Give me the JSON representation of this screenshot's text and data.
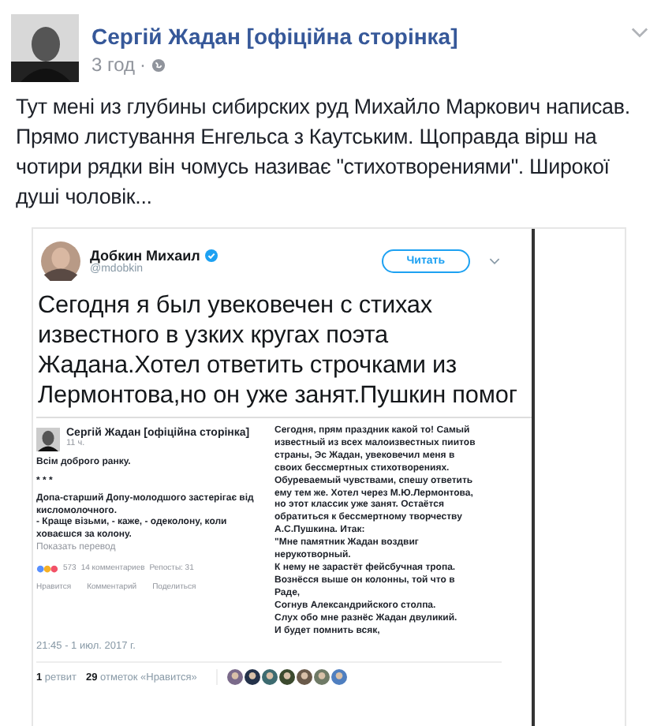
{
  "post": {
    "author": "Сергій Жадан [офіційна сторінка]",
    "time": "3 год",
    "separator": "·",
    "text": "Тут мені из глубины сибирских руд Михайло Маркович написав. Прямо листування Енгельса з Каутським. Щоправда вірш на чотири рядки він чомусь називає \"стихотворениями\". Широкої душі чоловік..."
  },
  "tweet": {
    "author": "Добкин Михаил",
    "verified": true,
    "handle": "@mdobkin",
    "follow_button": "Читать",
    "text": "Сегодня я был увековечен с стихах известного в узких кругах поэта Жадана.Хотел ответить строчками из Лермонтова,но он уже занят.Пушкин помог",
    "embedded_post": {
      "author": "Сергій Жадан [офіційна сторінка]",
      "time": "11 ч.",
      "greeting": "Всім доброго ранку.",
      "stars": "* * *",
      "poem": "Допа-старший Допу-молодшого застерігає від кисломолочного.\n- Краще візьми, - каже, - одеколону, коли ховаєшся за колону.",
      "translate_link": "Показать перевод",
      "reactions_count": "573",
      "comments": "14 комментариев",
      "shares": "Репосты: 31",
      "actions": [
        "Нравится",
        "Комментарий",
        "Поделиться"
      ]
    },
    "reply_text": "Сегодня, прям праздник какой то! Самый\nизвестный из всех малоизвестных пиитов\nстраны, Эс Жадан, увековечил меня в\nсвоих бессмертных стихотворениях.\nОбуреваемый чувствами, спешу ответить\nему тем же. Хотел через М.Ю.Лермонтова,\nно этот классик уже занят. Остаётся\nобратиться к бессмертному творчеству\nА.С.Пушкина. Итак:\n\"Мне памятник Жадан воздвиг\nнерукотворный.\nК нему не зарастёт фейсбучная тропа.\nВознёсся выше он колонны, той что в\nРаде,\nСогнув Александрийского столпа.\nСлух обо мне разнёс Жадан двуликий.\nИ будет помнить всяк,",
    "timestamp": "21:45 - 1 июл. 2017 г.",
    "retweets_count": "1",
    "retweets_label": "ретвит",
    "likes_count": "29",
    "likes_label": "отметок «Нравится»"
  }
}
